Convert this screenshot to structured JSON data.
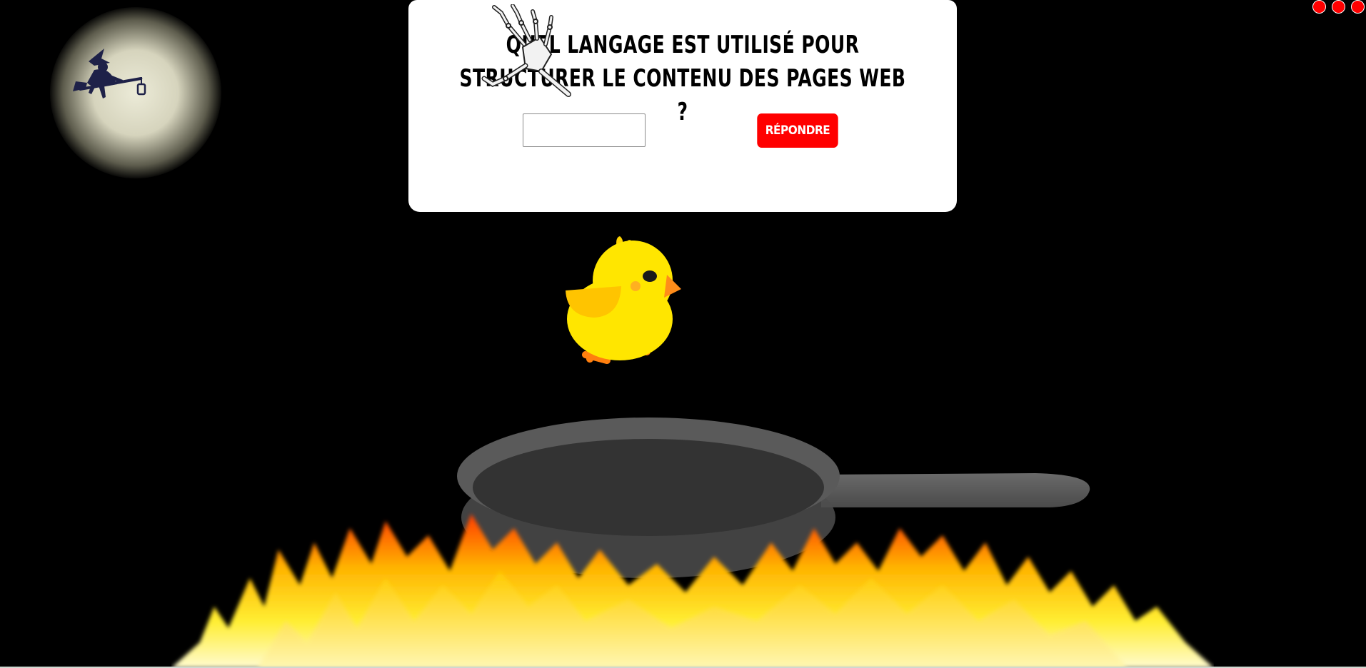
{
  "question": {
    "text": "Quel langage est utilisé pour structurer le contenu des pages web ?",
    "input_value": "",
    "answer_button_label": "Répondre"
  },
  "lives": {
    "count": 3,
    "color": "#ff0000"
  },
  "scene": {
    "background_color": "#000000",
    "moon_icon": "moon-icon",
    "witch_icon": "witch-on-broom-icon",
    "hand_icon": "skeleton-hand-icon",
    "chick_icon": "chick-icon",
    "pan_icon": "frying-pan-icon",
    "fire_icon": "fire-icon",
    "accent_color": "#ff0000",
    "chick_color": "#ffe600"
  }
}
